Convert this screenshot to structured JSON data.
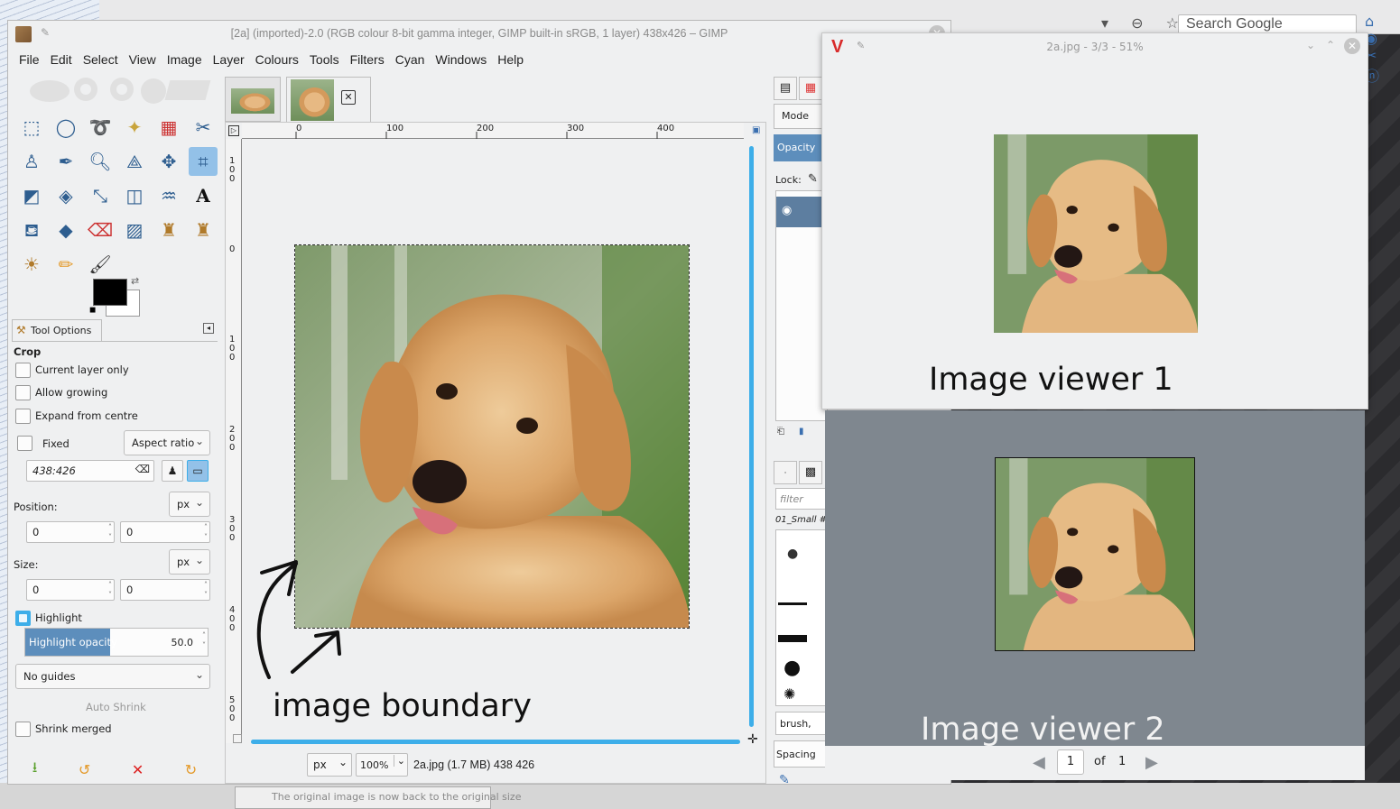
{
  "gimp": {
    "title": "[2a] (imported)-2.0 (RGB colour 8-bit gamma integer, GIMP built-in sRGB, 1 layer) 438x426 – GIMP",
    "menu": [
      "File",
      "Edit",
      "Select",
      "View",
      "Image",
      "Layer",
      "Colours",
      "Tools",
      "Filters",
      "Cyan",
      "Windows",
      "Help"
    ],
    "tool_options": {
      "tab_label": "Tool Options",
      "tool_name": "Crop",
      "current_layer_only": "Current layer only",
      "allow_growing": "Allow growing",
      "expand_from_centre": "Expand from centre",
      "fixed": "Fixed",
      "aspect_ratio": "Aspect ratio",
      "ratio_value": "438:426",
      "position_label": "Position:",
      "position_unit": "px",
      "position_x": "0",
      "position_y": "0",
      "size_label": "Size:",
      "size_unit": "px",
      "size_w": "0",
      "size_h": "0",
      "highlight": "Highlight",
      "highlight_opacity_label": "Highlight opacity",
      "highlight_opacity_value": "50.0",
      "guides": "No guides",
      "auto_shrink": "Auto Shrink",
      "shrink_merged": "Shrink merged"
    },
    "ruler_top": [
      "0",
      "100",
      "200",
      "300",
      "400"
    ],
    "ruler_left": [
      "1\n0\n0",
      "0",
      "1\n0\n0",
      "2\n0\n0",
      "3\n0\n0",
      "4\n0\n0",
      "5\n0\n0"
    ],
    "status": {
      "unit": "px",
      "zoom": "100%",
      "info": "2a.jpg (1.7 MB) 438 426"
    },
    "dock": {
      "mode": "Mode",
      "opacity": "Opacity",
      "lock": "Lock:",
      "filter": "filter",
      "brush_name": "01_Small #",
      "brush_tag": "brush,",
      "spacing": "Spacing"
    }
  },
  "annotations": {
    "image_boundary": "image boundary",
    "image_viewer_1": "Image viewer 1",
    "image_viewer_2": "Image viewer 2"
  },
  "viewer1": {
    "title": "2a.jpg - 3/3 - 51%"
  },
  "viewer2": {
    "page": "1",
    "of": "of",
    "total": "1"
  },
  "browser": {
    "search_placeholder": "Search Google"
  },
  "background": {
    "bottom_text": "The original image is now back to the original size"
  }
}
